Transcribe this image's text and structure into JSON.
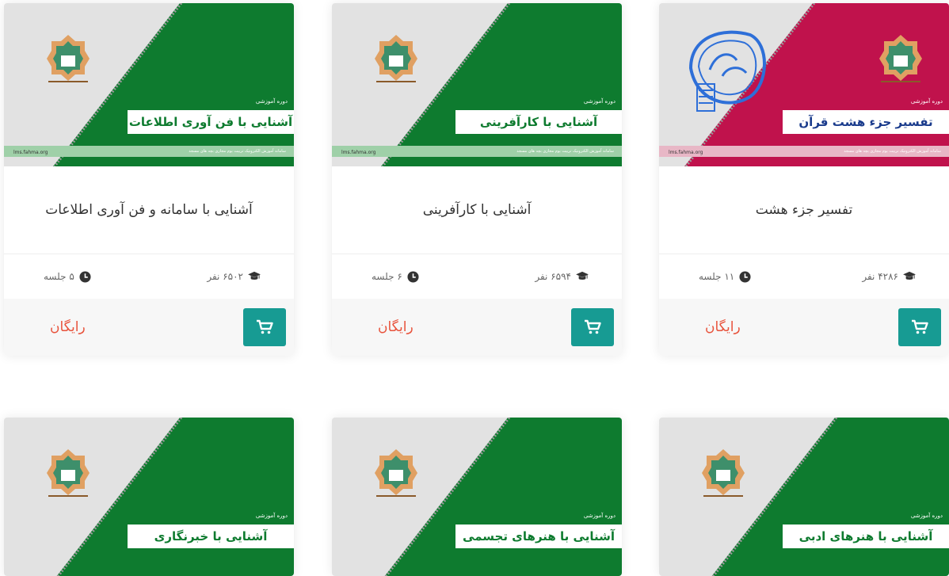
{
  "colors": {
    "green": "#0e7b2f",
    "crimson": "#c0124c",
    "banner_bg": "#e2e2e2",
    "title_blue": "#1a3b8c",
    "cart": "#179b93",
    "price": "#e8533c",
    "stamp_blue": "#2e6fd8"
  },
  "banner_common": {
    "tag": "دوره آموزشی",
    "url": "lms.fahma.org",
    "strip": "سامانه آموزش الکترونیک تربیت بوم مجازی بچه های مسجد"
  },
  "icons": {
    "students": "graduation-cap-icon",
    "sessions": "clock-icon",
    "cart": "cart-icon"
  },
  "courses": [
    {
      "banner_title": "تفسیر جزء هشت قرآن",
      "accent": "crimson",
      "title": "تفسیر جزء هشت",
      "students": "۴۲۸۶ نفر",
      "sessions": "۱۱ جلسه",
      "price": "رایگان"
    },
    {
      "banner_title": "آشنایی با کارآفرینی",
      "accent": "green",
      "title": "آشنایی با کارآفرینی",
      "students": "۶۵۹۴ نفر",
      "sessions": "۶ جلسه",
      "price": "رایگان"
    },
    {
      "banner_title": "آشنایی با فن آوری اطلاعات",
      "accent": "green",
      "title": "آشنایی با سامانه و فن آوری اطلاعات",
      "students": "۶۵۰۲ نفر",
      "sessions": "۵ جلسه",
      "price": "رایگان"
    },
    {
      "banner_title": "آشنایی با هنرهای ادبی",
      "accent": "green"
    },
    {
      "banner_title": "آشنایی با هنرهای تجسمی",
      "accent": "green"
    },
    {
      "banner_title": "آشنایی با خبرنگاری",
      "accent": "green"
    }
  ]
}
